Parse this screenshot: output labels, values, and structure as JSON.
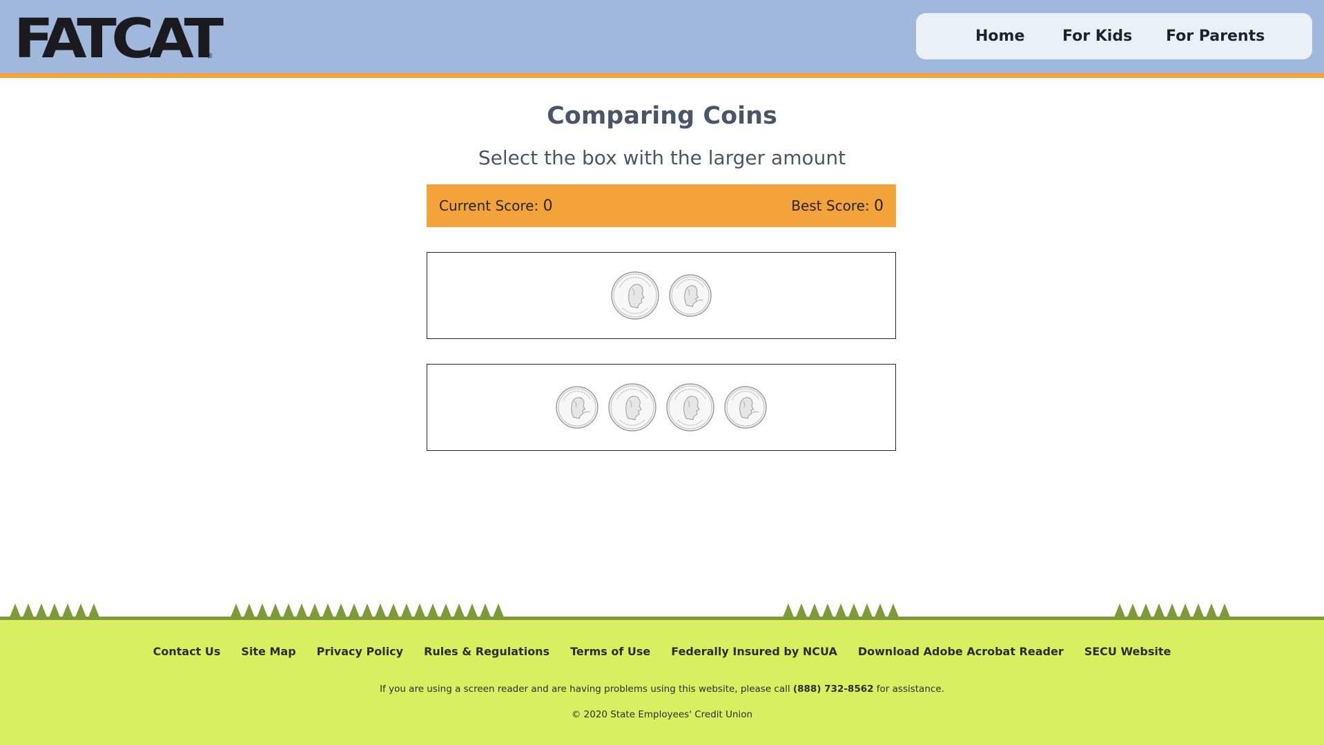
{
  "header": {
    "logo_text": "FATCAT",
    "logo_reg": "®",
    "nav": [
      {
        "label": "Home"
      },
      {
        "label": "For Kids"
      },
      {
        "label": "For Parents"
      }
    ]
  },
  "main": {
    "title": "Comparing Coins",
    "subtitle": "Select the box with the larger amount",
    "score": {
      "current_label": "Current Score:",
      "current_value": "0",
      "best_label": "Best Score:",
      "best_value": "0"
    },
    "boxes": [
      {
        "coins": [
          "quarter",
          "nickel"
        ]
      },
      {
        "coins": [
          "nickel",
          "quarter",
          "quarter",
          "nickel"
        ]
      }
    ]
  },
  "footer": {
    "links": [
      {
        "label": "Contact Us"
      },
      {
        "label": "Site Map"
      },
      {
        "label": "Privacy Policy"
      },
      {
        "label": "Rules & Regulations"
      },
      {
        "label": "Terms of Use"
      },
      {
        "label": "Federally Insured by NCUA"
      },
      {
        "label": "Download Adobe Acrobat Reader"
      },
      {
        "label": "SECU Website"
      }
    ],
    "note_before": "If you are using a screen reader and are having problems using this website, please call ",
    "note_phone": "(888) 732-8562",
    "note_after": " for assistance.",
    "copyright": "© 2020 State Employees' Credit Union"
  },
  "colors": {
    "header_bg": "#a0b8db",
    "accent_orange": "#f2a33c",
    "footer_green": "#d8f060",
    "grass_dark": "#7e9a3a"
  }
}
